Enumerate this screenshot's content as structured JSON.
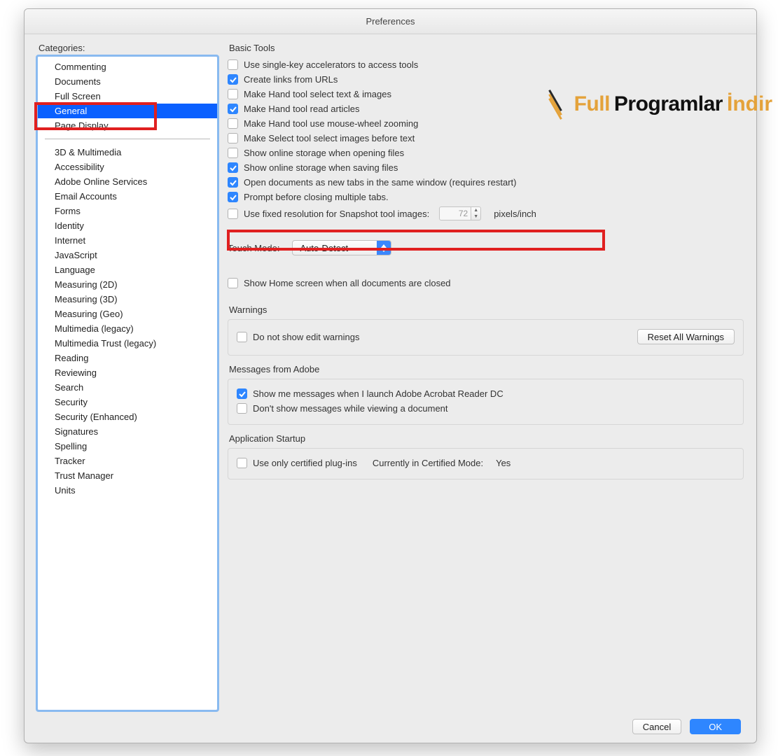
{
  "window": {
    "title": "Preferences"
  },
  "sidebar": {
    "label": "Categories:",
    "group1": [
      {
        "label": "Commenting"
      },
      {
        "label": "Documents"
      },
      {
        "label": "Full Screen"
      },
      {
        "label": "General",
        "selected": true
      },
      {
        "label": "Page Display"
      }
    ],
    "group2": [
      {
        "label": "3D & Multimedia"
      },
      {
        "label": "Accessibility"
      },
      {
        "label": "Adobe Online Services"
      },
      {
        "label": "Email Accounts"
      },
      {
        "label": "Forms"
      },
      {
        "label": "Identity"
      },
      {
        "label": "Internet"
      },
      {
        "label": "JavaScript"
      },
      {
        "label": "Language"
      },
      {
        "label": "Measuring (2D)"
      },
      {
        "label": "Measuring (3D)"
      },
      {
        "label": "Measuring (Geo)"
      },
      {
        "label": "Multimedia (legacy)"
      },
      {
        "label": "Multimedia Trust (legacy)"
      },
      {
        "label": "Reading"
      },
      {
        "label": "Reviewing"
      },
      {
        "label": "Search"
      },
      {
        "label": "Security"
      },
      {
        "label": "Security (Enhanced)"
      },
      {
        "label": "Signatures"
      },
      {
        "label": "Spelling"
      },
      {
        "label": "Tracker"
      },
      {
        "label": "Trust Manager"
      },
      {
        "label": "Units"
      }
    ]
  },
  "basic": {
    "title": "Basic Tools",
    "items": [
      {
        "label": "Use single-key accelerators to access tools",
        "checked": false
      },
      {
        "label": "Create links from URLs",
        "checked": true
      },
      {
        "label": "Make Hand tool select text & images",
        "checked": false
      },
      {
        "label": "Make Hand tool read articles",
        "checked": true
      },
      {
        "label": "Make Hand tool use mouse-wheel zooming",
        "checked": false
      },
      {
        "label": "Make Select tool select images before text",
        "checked": false
      },
      {
        "label": "Show online storage when opening files",
        "checked": false
      },
      {
        "label": "Show online storage when saving files",
        "checked": true
      },
      {
        "label": "Open documents as new tabs in the same window (requires restart)",
        "checked": true
      },
      {
        "label": "Prompt before closing multiple tabs.",
        "checked": true
      },
      {
        "label": "Use fixed resolution for Snapshot tool images:",
        "checked": false
      }
    ],
    "snapshot_value": "72",
    "snapshot_unit": "pixels/inch",
    "touch_label": "Touch Mode:",
    "touch_value": "Auto-Detect",
    "show_home": {
      "label": "Show Home screen when all documents are closed",
      "checked": false
    }
  },
  "warnings": {
    "title": "Warnings",
    "item": {
      "label": "Do not show edit warnings",
      "checked": false
    },
    "reset_btn": "Reset All Warnings"
  },
  "messages": {
    "title": "Messages from Adobe",
    "items": [
      {
        "label": "Show me messages when I launch Adobe Acrobat Reader DC",
        "checked": true
      },
      {
        "label": "Don't show messages while viewing a document",
        "checked": false
      }
    ]
  },
  "startup": {
    "title": "Application Startup",
    "item": {
      "label": "Use only certified plug-ins",
      "checked": false
    },
    "mode_label": "Currently in Certified Mode:",
    "mode_value": "Yes"
  },
  "footer": {
    "cancel": "Cancel",
    "ok": "OK"
  },
  "watermark": {
    "t1": "Full",
    "t2": "Programlar",
    "t3": "İndir"
  }
}
